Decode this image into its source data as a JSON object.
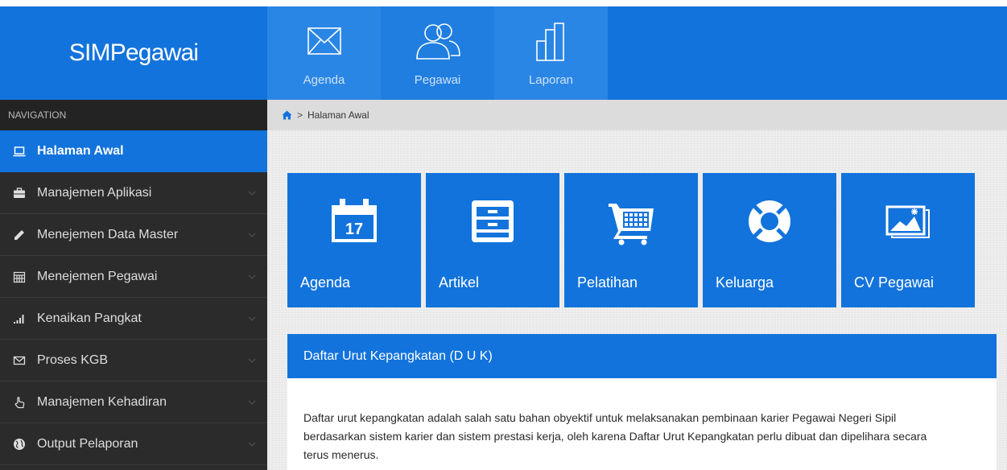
{
  "app": {
    "title": "SIMPegawai"
  },
  "topnav": [
    {
      "label": "Agenda",
      "icon": "envelope-icon"
    },
    {
      "label": "Pegawai",
      "icon": "users-icon"
    },
    {
      "label": "Laporan",
      "icon": "bar-chart-icon"
    }
  ],
  "sidebar": {
    "header": "NAVIGATION",
    "items": [
      {
        "label": "Halaman Awal",
        "icon": "laptop-icon",
        "active": true
      },
      {
        "label": "Manajemen Aplikasi",
        "icon": "briefcase-icon"
      },
      {
        "label": "Menejemen Data Master",
        "icon": "pencil-icon"
      },
      {
        "label": "Menejemen Pegawai",
        "icon": "calendar-icon"
      },
      {
        "label": "Kenaikan Pangkat",
        "icon": "signal-icon"
      },
      {
        "label": "Proses KGB",
        "icon": "envelope-icon"
      },
      {
        "label": "Manajemen Kehadiran",
        "icon": "hand-pointer-icon"
      },
      {
        "label": "Output Pelaporan",
        "icon": "globe-icon"
      }
    ]
  },
  "breadcrumb": {
    "current": "Halaman Awal"
  },
  "tiles": [
    {
      "label": "Agenda",
      "icon": "calendar-17-icon",
      "icon_text": "17"
    },
    {
      "label": "Artikel",
      "icon": "cabinet-icon"
    },
    {
      "label": "Pelatihan",
      "icon": "shopping-cart-icon"
    },
    {
      "label": "Keluarga",
      "icon": "life-ring-icon"
    },
    {
      "label": "CV Pegawai",
      "icon": "picture-icon"
    }
  ],
  "panel": {
    "title": "Daftar Urut Kepangkatan (D U K)",
    "body": "Daftar urut kepangkatan adalah salah satu bahan obyektif untuk melaksanakan pembinaan karier Pegawai Negeri Sipil berdasarkan sistem karier dan sistem prestasi kerja, oleh karena Daftar Urut Kepangkatan perlu dibuat dan dipelihara secara terus menerus."
  },
  "colors": {
    "brand_blue": "#1273dc",
    "sidebar_dark": "#2b2b2b",
    "topnav_tile": "#2a86e4"
  }
}
